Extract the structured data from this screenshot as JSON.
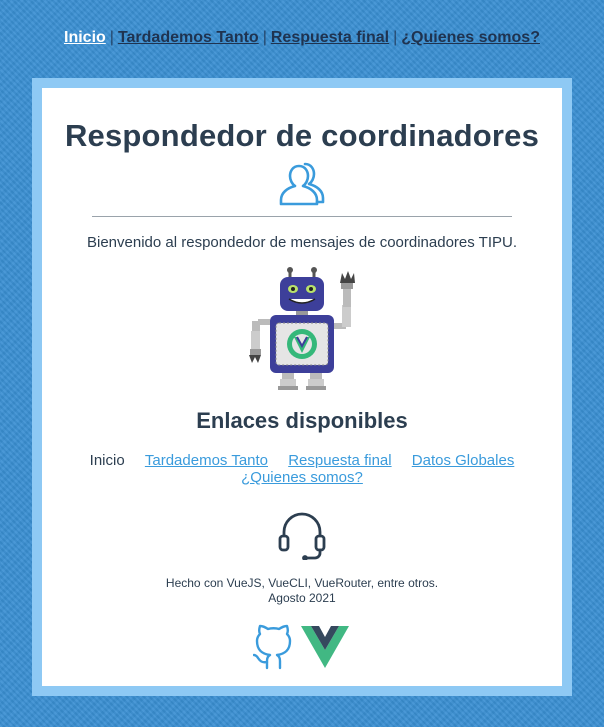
{
  "topnav": {
    "items": [
      {
        "label": "Inicio",
        "active": true
      },
      {
        "label": "Tardademos Tanto",
        "active": false
      },
      {
        "label": "Respuesta final",
        "active": false
      },
      {
        "label": "¿Quienes somos?",
        "active": false
      }
    ],
    "separator": "|"
  },
  "main": {
    "title": "Respondedor de coordinadores",
    "title_icon": "users-icon",
    "welcome": "Bienvenido al respondedor de mensajes de coordinadores TIPU.",
    "illustration": "robot-illustration",
    "links_heading": "Enlaces disponibles",
    "links": [
      {
        "label": "Inicio",
        "is_link": false
      },
      {
        "label": "Tardademos Tanto",
        "is_link": true
      },
      {
        "label": "Respuesta final",
        "is_link": true
      },
      {
        "label": "Datos Globales",
        "is_link": true
      },
      {
        "label": "¿Quienes somos?",
        "is_link": true
      }
    ],
    "support_icon": "headset-icon",
    "footer_line1": "Hecho con VueJS, VueCLI, VueRouter, entre otros.",
    "footer_line2": "Agosto 2021",
    "logos": [
      "github-icon",
      "vue-logo-icon"
    ]
  },
  "colors": {
    "background": "#3a8fd3",
    "frame": "#8ec9f4",
    "link": "#3a9bdc",
    "text": "#2c3e50",
    "nav_active": "#ffffff"
  }
}
